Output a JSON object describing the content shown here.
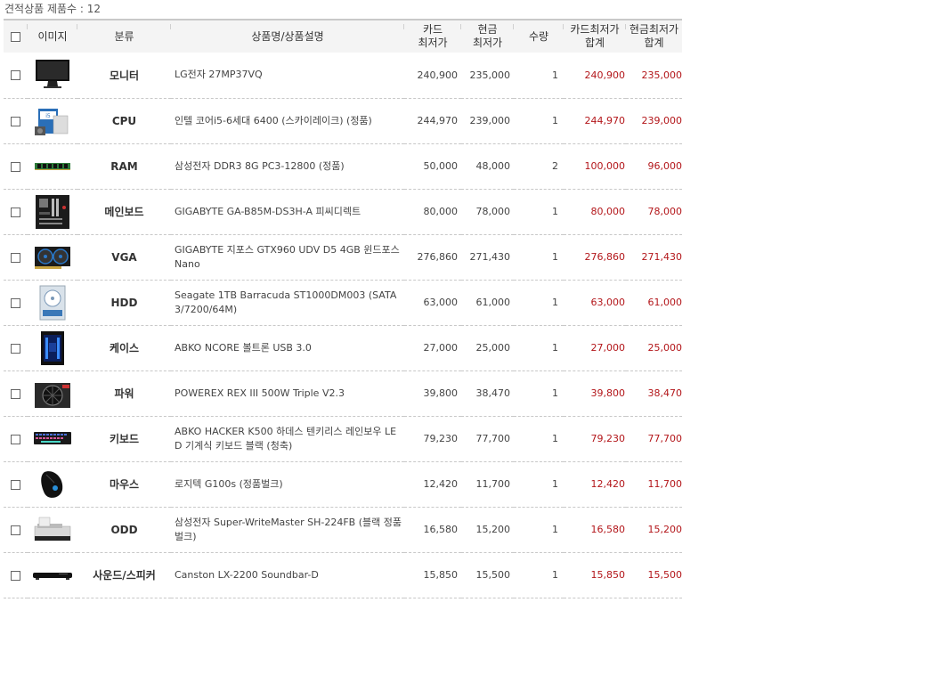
{
  "summary": {
    "label": "견적상품 제품수 :",
    "count": "12"
  },
  "headers": {
    "image": "이미지",
    "category": "분류",
    "name": "상품명/상품설명",
    "card_price": [
      "카드",
      "최저가"
    ],
    "cash_price": [
      "현금",
      "최저가"
    ],
    "qty": "수량",
    "card_total": [
      "카드최저가",
      "합계"
    ],
    "cash_total": [
      "현금최저가",
      "합계"
    ]
  },
  "rows": [
    {
      "category": "모니터",
      "name": "LG전자 27MP37VQ",
      "card": "240,900",
      "cash": "235,000",
      "qty": "1",
      "card_total": "240,900",
      "cash_total": "235,000",
      "icon": "monitor-icon"
    },
    {
      "category": "CPU",
      "name": "인텔 코어i5-6세대 6400 (스카이레이크) (정품)",
      "card": "244,970",
      "cash": "239,000",
      "qty": "1",
      "card_total": "244,970",
      "cash_total": "239,000",
      "icon": "cpu-icon"
    },
    {
      "category": "RAM",
      "name": "삼성전자 DDR3 8G PC3-12800 (정품)",
      "card": "50,000",
      "cash": "48,000",
      "qty": "2",
      "card_total": "100,000",
      "cash_total": "96,000",
      "icon": "ram-icon"
    },
    {
      "category": "메인보드",
      "name": "GIGABYTE GA-B85M-DS3H-A 피씨디렉트",
      "card": "80,000",
      "cash": "78,000",
      "qty": "1",
      "card_total": "80,000",
      "cash_total": "78,000",
      "icon": "motherboard-icon"
    },
    {
      "category": "VGA",
      "name": "GIGABYTE 지포스 GTX960 UDV D5 4GB 윈드포스 Nano",
      "card": "276,860",
      "cash": "271,430",
      "qty": "1",
      "card_total": "276,860",
      "cash_total": "271,430",
      "icon": "graphics-card-icon"
    },
    {
      "category": "HDD",
      "name": "Seagate 1TB Barracuda ST1000DM003 (SATA3/7200/64M)",
      "card": "63,000",
      "cash": "61,000",
      "qty": "1",
      "card_total": "63,000",
      "cash_total": "61,000",
      "icon": "hdd-icon"
    },
    {
      "category": "케이스",
      "name": "ABKO NCORE 볼트론 USB 3.0",
      "card": "27,000",
      "cash": "25,000",
      "qty": "1",
      "card_total": "27,000",
      "cash_total": "25,000",
      "icon": "pc-case-icon"
    },
    {
      "category": "파워",
      "name": "POWEREX REX III 500W Triple V2.3",
      "card": "39,800",
      "cash": "38,470",
      "qty": "1",
      "card_total": "39,800",
      "cash_total": "38,470",
      "icon": "power-supply-icon"
    },
    {
      "category": "키보드",
      "name": "ABKO HACKER K500 하데스 텐키리스 레인보우 LED 기계식 키보드 블랙 (청축)",
      "card": "79,230",
      "cash": "77,700",
      "qty": "1",
      "card_total": "79,230",
      "cash_total": "77,700",
      "icon": "keyboard-icon"
    },
    {
      "category": "마우스",
      "name": "로지텍 G100s (정품벌크)",
      "card": "12,420",
      "cash": "11,700",
      "qty": "1",
      "card_total": "12,420",
      "cash_total": "11,700",
      "icon": "mouse-icon"
    },
    {
      "category": "ODD",
      "name": "삼성전자 Super-WriteMaster SH-224FB (블랙 정품벌크)",
      "card": "16,580",
      "cash": "15,200",
      "qty": "1",
      "card_total": "16,580",
      "cash_total": "15,200",
      "icon": "optical-drive-icon"
    },
    {
      "category": "사운드/스피커",
      "name": "Canston LX-2200 Soundbar-D",
      "card": "15,850",
      "cash": "15,500",
      "qty": "1",
      "card_total": "15,850",
      "cash_total": "15,500",
      "icon": "soundbar-icon"
    }
  ],
  "colors": {
    "total_text": "#b3161a",
    "header_bg": "#f4f4f4"
  }
}
